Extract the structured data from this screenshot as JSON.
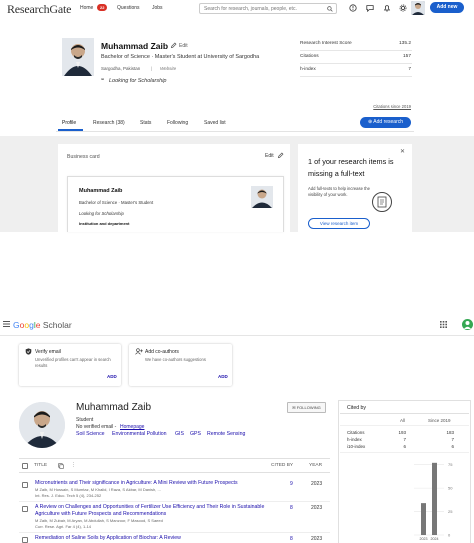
{
  "researchgate": {
    "logo": "ResearchGate",
    "nav": {
      "home": "Home",
      "home_badge": "22",
      "questions": "Questions",
      "jobs": "Jobs",
      "search_placeholder": "Search for research, journals, people, etc.",
      "add_new": "Add new"
    },
    "profile": {
      "name": "Muhammad Zaib",
      "edit": "Edit",
      "title": "Bachelor of Science · Master's Student at University of Sargodha",
      "location": "Sargodha, Pakistan",
      "separator": "|",
      "website": "Website",
      "looking": "Looking for Scholarship"
    },
    "stats": [
      {
        "label": "Research Interest Score",
        "value": "135.2"
      },
      {
        "label": "Citations",
        "value": "157"
      },
      {
        "label": "h-index",
        "value": "7"
      }
    ],
    "citations_link": "Citations since 2019",
    "tabs": [
      "Profile",
      "Research (38)",
      "Stats",
      "Following",
      "Saved list"
    ],
    "add_research": "Add research",
    "business_card": {
      "title": "Business card",
      "edit": "Edit",
      "name": "Muhammad Zaib",
      "degree": "Bachelor of Science · Master's Student",
      "looking": "Looking for Scholarship",
      "institution": "Institution and department"
    },
    "fulltext": {
      "title": "1 of your research items is missing a full-text",
      "text": "Add full-texts to help increase the visibility of your work.",
      "button": "View research item"
    },
    "colors": {
      "accent": "#1a5fcc",
      "badge": "#d93025"
    }
  },
  "scholar": {
    "logo_google": [
      "G",
      "o",
      "o",
      "g",
      "l",
      "e"
    ],
    "logo_scholar": "Scholar",
    "cards": [
      {
        "title": "Verify email",
        "text": "Unverified profiles can't appear in search results",
        "action": "ADD"
      },
      {
        "title": "Add co-authors",
        "text": "We have co-authors suggestions",
        "action": "ADD"
      }
    ],
    "profile": {
      "name": "Muhammad Zaib",
      "follow": "FOLLOWING",
      "role": "Student",
      "email": "No verified email -",
      "homepage": "Homepage",
      "interests": [
        "Soil Science",
        "Environmental Pollution",
        "GIS",
        "GPS",
        "Remote Sensing"
      ]
    },
    "table": {
      "title_col": "TITLE",
      "cited_col": "CITED BY",
      "year_col": "YEAR"
    },
    "articles": [
      {
        "title": "Micronutrients and Their significance in Agriculture: A Mini Review with Future Prospects",
        "authors": "M Zaib, M Hossain, S Mumtaz, M Khalid, I Raza, S Akbar, M Danish, ...",
        "venue": "Int. Res. J. Educ. Tech 5 (4), 234-252",
        "cited": "9",
        "year": "2023"
      },
      {
        "title": "A Review on Challenges and Opportunities of Fertilizer Use Efficiency and Their Role in Sustainable Agriculture with Future Prospects and Recommendations",
        "authors": "M Zaib, M Zubair, M Aryan, M Abdullah, S Manzoor, F Masood, S Saeed",
        "venue": "Curr. Rese. Agri. Far 4 (4), 1-14",
        "cited": "8",
        "year": "2023"
      },
      {
        "title": "Remediation of Saline Soils by Application of Biochar: A Review",
        "authors": "",
        "venue": "",
        "cited": "8",
        "year": "2023"
      }
    ],
    "cited_by": {
      "title": "Cited by",
      "col_all": "All",
      "col_since": "Since 2019",
      "rows": [
        {
          "label": "Citations",
          "all": "193",
          "since": "183"
        },
        {
          "label": "h-index",
          "all": "7",
          "since": "7"
        },
        {
          "label": "i10-index",
          "all": "6",
          "since": "6"
        }
      ]
    },
    "chart_data": {
      "type": "bar",
      "categories": [
        "2023",
        "2024"
      ],
      "values": [
        34,
        77
      ],
      "title": "",
      "xlabel": "",
      "ylabel": "",
      "ylim": [
        0,
        80
      ],
      "yticks": [
        "75",
        "50",
        "25",
        "0"
      ],
      "bar_color": "#777777"
    }
  }
}
